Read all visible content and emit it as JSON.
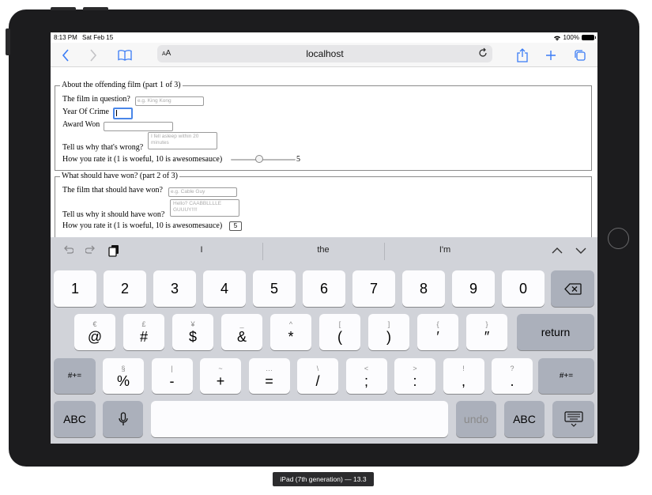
{
  "status": {
    "time": "8:13 PM",
    "date": "Sat Feb 15",
    "battery": "100%"
  },
  "browser": {
    "aa_small": "A",
    "aa_big": "A",
    "url": "localhost"
  },
  "form": {
    "part1": {
      "legend": "About the offending film (part 1 of 3)",
      "film_label": "The film in question?",
      "film_placeholder": "e.g. King Kong",
      "year_label": "Year Of Crime",
      "award_label": "Award Won",
      "why_label": "Tell us why that's wrong?",
      "why_placeholder": "I fell asleep within 20 minutes",
      "rate_label": "How you rate it (1 is woeful, 10 is awesomesauce)",
      "rate_value": "5",
      "rate_fraction": 0.444
    },
    "part2": {
      "legend": "What should have won? (part 2 of 3)",
      "film_label": "The film that should have won?",
      "film_placeholder": "e.g. Cable Guy",
      "why_label": "Tell us why it should have won?",
      "why_placeholder": "Hello? CAABBLLLLE GUUUY!!!!",
      "rate_label": "How you rate it (1 is woeful, 10 is awesomesauce)",
      "rate_value": "5"
    }
  },
  "keyboard": {
    "suggestions": [
      "I",
      "the",
      "I'm"
    ],
    "row1": [
      "1",
      "2",
      "3",
      "4",
      "5",
      "6",
      "7",
      "8",
      "9",
      "0"
    ],
    "row2": [
      {
        "sub": "€",
        "main": "@"
      },
      {
        "sub": "£",
        "main": "#"
      },
      {
        "sub": "¥",
        "main": "$"
      },
      {
        "sub": "_",
        "main": "&"
      },
      {
        "sub": "^",
        "main": "*"
      },
      {
        "sub": "[",
        "main": "("
      },
      {
        "sub": "]",
        "main": ")"
      },
      {
        "sub": "{",
        "main": "′"
      },
      {
        "sub": "}",
        "main": "″"
      }
    ],
    "return_label": "return",
    "symbols_label": "#+=",
    "row3": [
      {
        "sub": "§",
        "main": "%"
      },
      {
        "sub": "|",
        "main": "-"
      },
      {
        "sub": "~",
        "main": "+"
      },
      {
        "sub": "…",
        "main": "="
      },
      {
        "sub": "\\",
        "main": "/"
      },
      {
        "sub": "<",
        "main": ";"
      },
      {
        "sub": ">",
        "main": ":"
      },
      {
        "sub": "!",
        "main": ","
      },
      {
        "sub": "?",
        "main": "."
      }
    ],
    "abc_label": "ABC",
    "undo_label": "undo"
  },
  "device_label": "iPad (7th generation) — 13.3"
}
